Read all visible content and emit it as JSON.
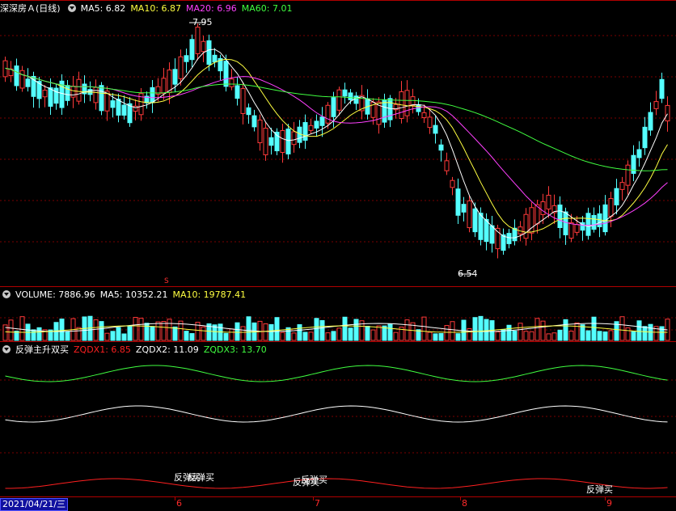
{
  "header": {
    "stock_name": "深深房Ａ",
    "period": "(日线)",
    "ma5_label": "MA5: 6.82",
    "ma10_label": "MA10: 6.87",
    "ma20_label": "MA20: 6.96",
    "ma60_label": "MA60: 7.01"
  },
  "price_panel": {
    "high_label": "7.95",
    "low_label": "6.54",
    "marker_label": "S"
  },
  "volume_header": {
    "volume_label": "VOLUME: 7886.96",
    "ma5_label": "MA5: 10352.21",
    "ma10_label": "MA10: 19787.41"
  },
  "indicator_header": {
    "name": "反弹主升双买",
    "zqdx1_label": "ZQDX1: 6.85",
    "zqdx2_label": "ZQDX2: 11.09",
    "zqdx3_label": "ZQDX3: 13.70"
  },
  "signals": [
    "反弹买",
    "反弹买",
    "反弹买",
    "反弹买",
    "反弹买"
  ],
  "date_bar": {
    "selected_date": "2021/04/21/三",
    "months": [
      "6",
      "7",
      "8",
      "9"
    ]
  },
  "colors": {
    "up": "#ff3a3a",
    "down": "#54ffff",
    "ma5": "#ffffff",
    "ma10": "#ffff40",
    "ma20": "#ff40ff",
    "ma60": "#40ff40",
    "grid": "#7a0000",
    "separator": "#b00000",
    "zqdx1": "#ff2020",
    "zqdx2": "#ffffff",
    "zqdx3": "#40ff40"
  }
}
